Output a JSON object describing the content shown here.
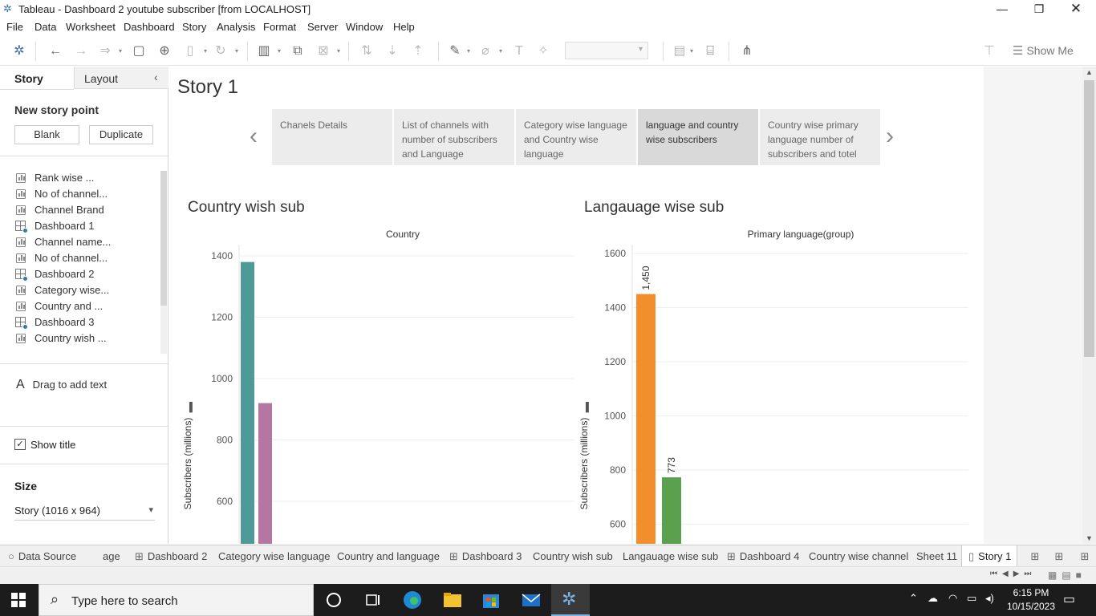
{
  "window": {
    "title": "Tableau - Dashboard 2 youtube subscriber [from LOCALHOST]"
  },
  "menu": [
    "File",
    "Data",
    "Worksheet",
    "Dashboard",
    "Story",
    "Analysis",
    "Format",
    "Server",
    "Window",
    "Help"
  ],
  "toolbar": {
    "show_me": "Show Me"
  },
  "left_pane": {
    "tab_story": "Story",
    "tab_layout": "Layout",
    "new_story_point": "New story point",
    "blank": "Blank",
    "duplicate": "Duplicate",
    "sheets": [
      {
        "label": "Rank wise ...",
        "kind": "worksheet"
      },
      {
        "label": "No of channel...",
        "kind": "worksheet"
      },
      {
        "label": "Channel Brand",
        "kind": "worksheet"
      },
      {
        "label": "Dashboard 1",
        "kind": "dashboard"
      },
      {
        "label": "Channel name...",
        "kind": "worksheet"
      },
      {
        "label": "No of channel...",
        "kind": "worksheet"
      },
      {
        "label": "Dashboard 2",
        "kind": "dashboard"
      },
      {
        "label": "Category wise...",
        "kind": "worksheet"
      },
      {
        "label": "Country and ...",
        "kind": "worksheet"
      },
      {
        "label": "Dashboard 3",
        "kind": "dashboard"
      },
      {
        "label": "Country wish ...",
        "kind": "worksheet"
      }
    ],
    "drag_text": "Drag to add text",
    "show_title": "Show title",
    "show_title_checked": true,
    "size_label": "Size",
    "size_value": "Story (1016 x 964)"
  },
  "story": {
    "title": "Story 1",
    "points": [
      {
        "text": "Chanels Details",
        "active": false
      },
      {
        "text": "List of channels with number of subscribers and Language",
        "active": false
      },
      {
        "text": "Category wise language and Country wise language",
        "active": false
      },
      {
        "text": "language and country wise subscribers",
        "active": true
      },
      {
        "text": "Country wise primary language number of subscribers and totel",
        "active": false
      }
    ]
  },
  "chart_data": [
    {
      "type": "bar",
      "title": "Country wish sub",
      "header": "Country",
      "ylabel": "Subscribers (millions)",
      "ylim": [
        500,
        1400
      ],
      "yticks": [
        600,
        800,
        1000,
        1200,
        1400
      ],
      "bars": [
        {
          "value": 1380,
          "color": "#4e9a96",
          "label": ""
        },
        {
          "value": 920,
          "color": "#b576a1",
          "label": ""
        }
      ]
    },
    {
      "type": "bar",
      "title": "Langauage wise sub",
      "header": "Primary language(group)",
      "ylabel": "Subscribers (millions)",
      "ylim": [
        500,
        1600
      ],
      "yticks": [
        600,
        800,
        1000,
        1200,
        1400,
        1600
      ],
      "bars": [
        {
          "value": 1450,
          "color": "#f28e2b",
          "label": "1,450"
        },
        {
          "value": 773,
          "color": "#59a14f",
          "label": "773"
        }
      ]
    }
  ],
  "sheet_tabs": [
    {
      "label": "Data Source",
      "active": false
    },
    {
      "label": "age",
      "active": false
    },
    {
      "label": "Dashboard 2",
      "active": false
    },
    {
      "label": "Category wise language",
      "active": false
    },
    {
      "label": "Country and language",
      "active": false
    },
    {
      "label": "Dashboard 3",
      "active": false
    },
    {
      "label": "Country wish sub",
      "active": false
    },
    {
      "label": "Langauage wise sub",
      "active": false
    },
    {
      "label": "Dashboard 4",
      "active": false
    },
    {
      "label": "Country wise channel",
      "active": false
    },
    {
      "label": "Sheet 11",
      "active": false
    },
    {
      "label": "Story 1",
      "active": true
    }
  ],
  "taskbar": {
    "search_placeholder": "Type here to search",
    "time": "6:15 PM",
    "date": "10/15/2023"
  }
}
